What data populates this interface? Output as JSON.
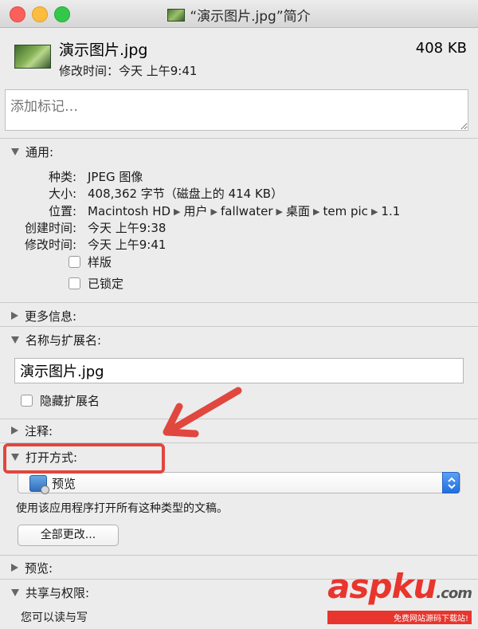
{
  "window": {
    "title": "“演示图片.jpg”简介"
  },
  "header": {
    "file_name": "演示图片.jpg",
    "file_size": "408 KB",
    "modified": "修改时间：今天 上午9:41"
  },
  "tags": {
    "placeholder": "添加标记…"
  },
  "general": {
    "header": "通用:",
    "rows": [
      {
        "label": "种类:",
        "value": "JPEG 图像"
      },
      {
        "label": "大小:",
        "value": "408,362 字节（磁盘上的 414 KB）"
      },
      {
        "label": "位置:",
        "value": ""
      },
      {
        "label": "创建时间:",
        "value": "今天 上午9:38"
      },
      {
        "label": "修改时间:",
        "value": "今天 上午9:41"
      }
    ],
    "path": [
      "Macintosh HD",
      "用户",
      "fallwater",
      "桌面",
      "tem pic",
      "1.1"
    ],
    "stationery_label": "样版",
    "locked_label": "已锁定"
  },
  "more_info": {
    "header": "更多信息:"
  },
  "name_ext": {
    "header": "名称与扩展名:",
    "value": "演示图片.jpg",
    "hide_ext_label": "隐藏扩展名"
  },
  "comments": {
    "header": "注释:"
  },
  "open_with": {
    "header": "打开方式:",
    "app": "预览",
    "note": "使用该应用程序打开所有这种类型的文稿。",
    "change_all": "全部更改..."
  },
  "preview": {
    "header": "预览:"
  },
  "sharing": {
    "header": "共享与权限:",
    "text": "您可以读与写"
  },
  "watermark": {
    "logo": "asp",
    "logo_ku": "ku",
    "com": ".com",
    "sub": "免费网站源码下载站!"
  },
  "colors": {
    "annotation": "#e0473f",
    "select_accent": "#1f6fe0"
  }
}
